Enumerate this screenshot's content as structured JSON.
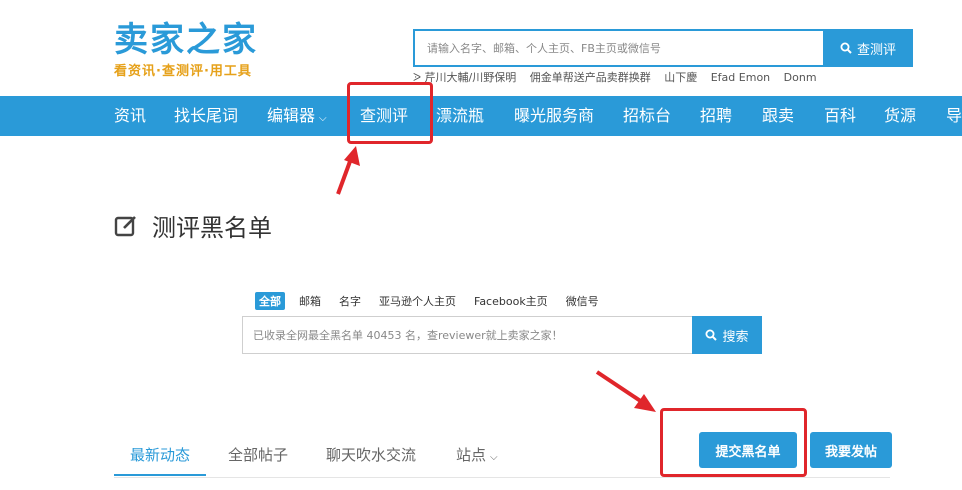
{
  "logo": {
    "title": "卖家之家",
    "slogan": "看资讯·查测评·用工具"
  },
  "top_search": {
    "placeholder": "请输入名字、邮箱、个人主页、FB主页或微信号",
    "button_label": "查测评",
    "hot_words": [
      "ᐷ 芹川大輔/川野保明",
      "佣金单帮送产品卖群换群",
      "山下慶",
      "Efad Emon",
      "Donm"
    ]
  },
  "nav": {
    "items": [
      "资讯",
      "找长尾词",
      "编辑器",
      "查测评",
      "漂流瓶",
      "曝光服务商",
      "招标台",
      "招聘",
      "跟卖",
      "百科",
      "货源",
      "导"
    ]
  },
  "page_title": "测评黑名单",
  "blacklist_search": {
    "filters": [
      "全部",
      "邮箱",
      "名字",
      "亚马逊个人主页",
      "Facebook主页",
      "微信号"
    ],
    "active_filter": "全部",
    "placeholder": "已收录全网最全黑名单 40453 名，查reviewer就上卖家之家！",
    "button_label": "搜索"
  },
  "tabs": {
    "items": [
      "最新动态",
      "全部帖子",
      "聊天吹水交流",
      "站点"
    ],
    "active": "最新动态"
  },
  "actions": {
    "submit_blacklist": "提交黑名单",
    "post": "我要发帖"
  },
  "colors": {
    "brand_blue": "#2a9ad8",
    "logo_orange": "#e6a11a",
    "highlight_red": "#e0262b"
  }
}
